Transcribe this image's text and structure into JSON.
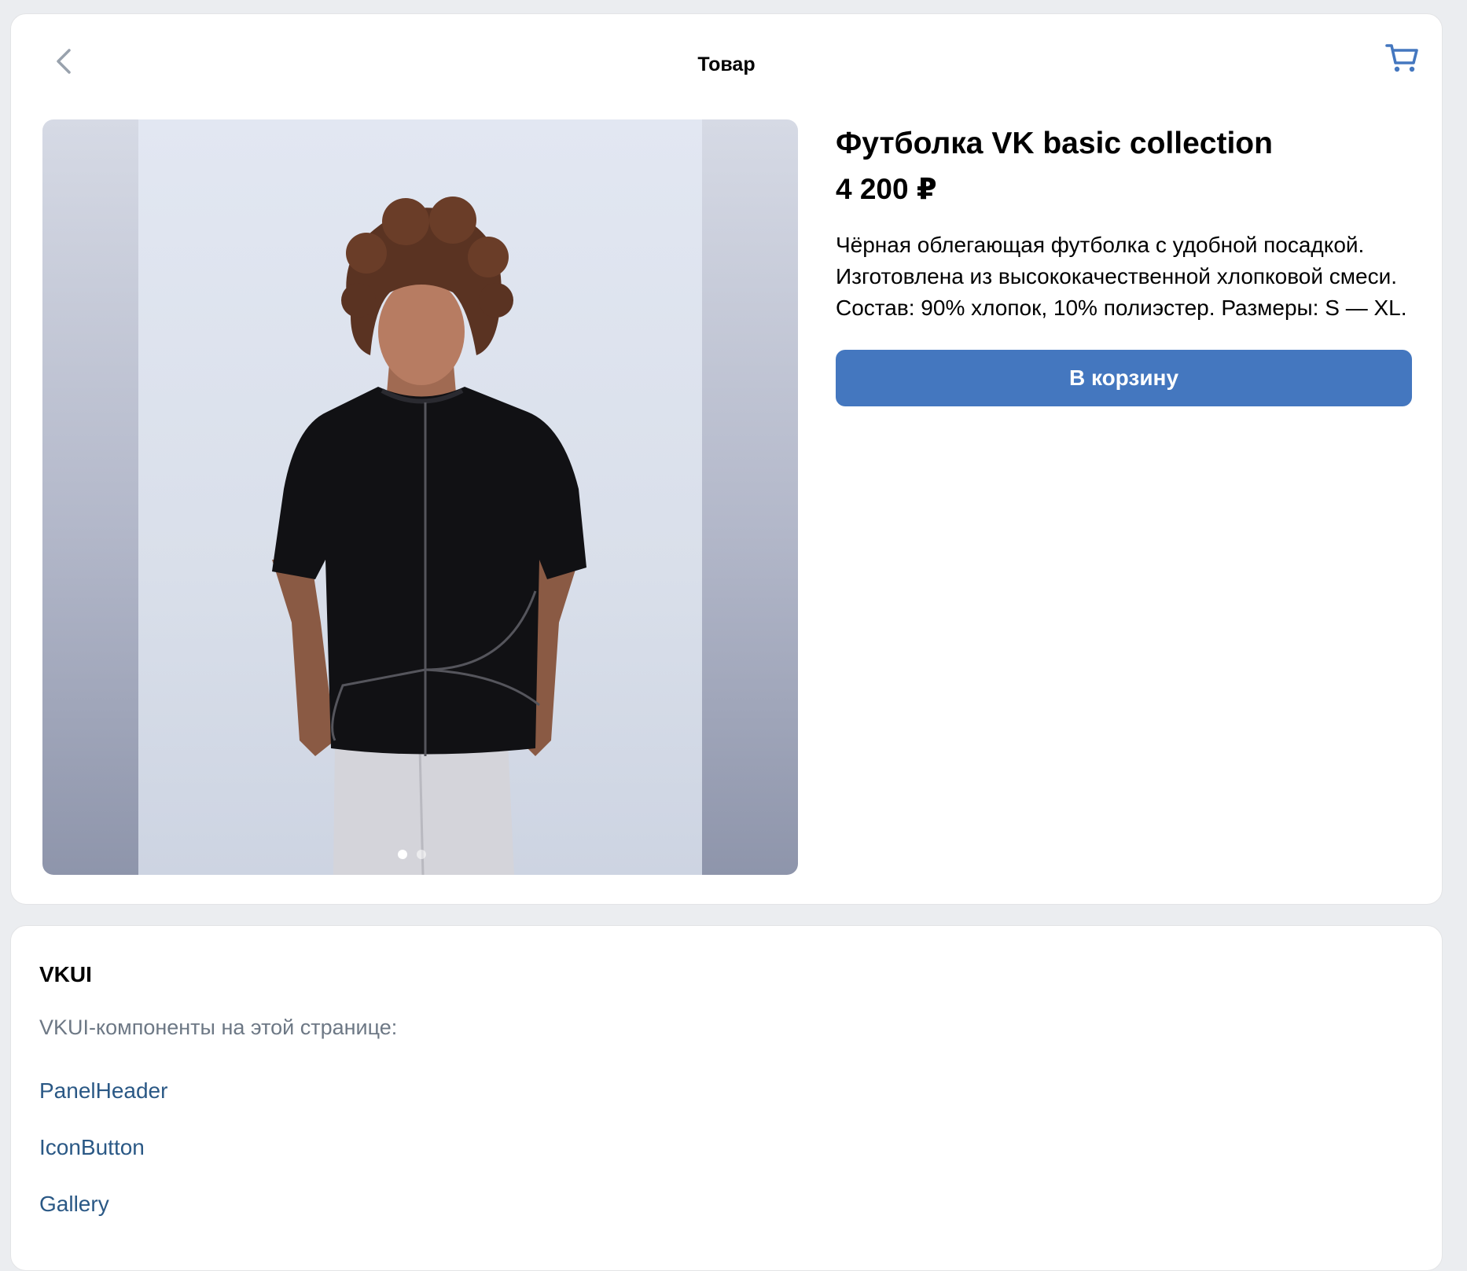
{
  "colors": {
    "page_background": "#ebedf0",
    "card_background": "#ffffff",
    "accent": "#4477bf",
    "link": "#2a5885",
    "secondary_text": "#6d7885"
  },
  "header": {
    "title": "Товар",
    "back_icon": "chevron-left-icon",
    "cart_icon": "shopping-cart-icon"
  },
  "gallery": {
    "slide_count": 2,
    "active_slide": 0
  },
  "product": {
    "title": "Футболка VK basic collection",
    "price": "4 200 ₽",
    "description": "Чёрная облегающая футболка с удобной посадкой. Изготовлена из высококачественной хлопковой смеси. Состав: 90% хлопок, 10% полиэстер. Размеры: S — XL.",
    "add_to_cart_label": "В корзину"
  },
  "vkui": {
    "title": "VKUI",
    "subtitle": "VKUI-компоненты на этой странице:",
    "links": [
      "PanelHeader",
      "IconButton",
      "Gallery"
    ]
  }
}
